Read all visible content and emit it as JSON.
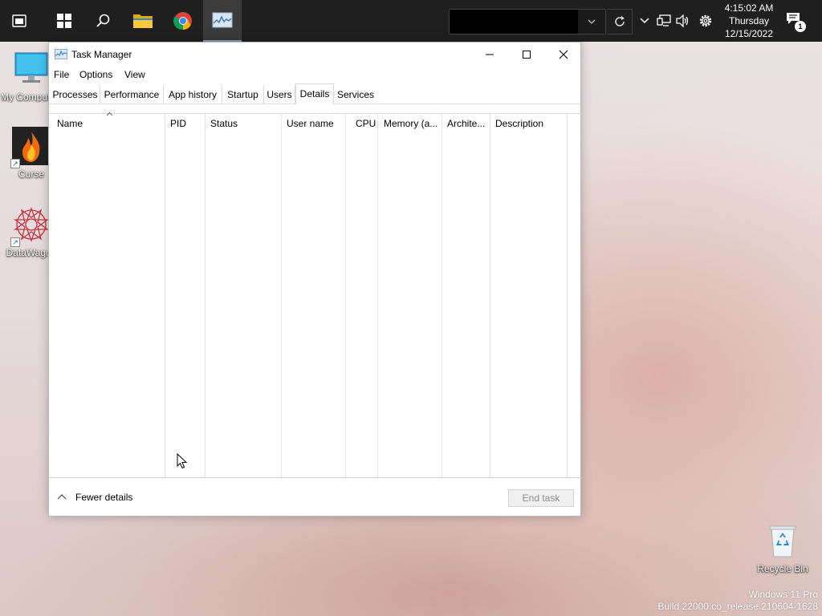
{
  "taskbar": {
    "apps": [
      {
        "name": "widgets"
      },
      {
        "name": "start"
      },
      {
        "name": "search"
      },
      {
        "name": "file-explorer"
      },
      {
        "name": "chrome"
      },
      {
        "name": "task-manager"
      }
    ],
    "search_value": "",
    "clock": {
      "time": "4:15:02 AM",
      "day": "Thursday",
      "date": "12/15/2022"
    },
    "notification_count": "1"
  },
  "desktop": {
    "icons": [
      {
        "label": "My Computer"
      },
      {
        "label": "Curse"
      },
      {
        "label": "DataWagon"
      },
      {
        "label": "Recycle Bin"
      }
    ],
    "watermark": {
      "line1": "Windows 11 Pro",
      "line2": "Build 22000.co_release.210604-1628"
    }
  },
  "window": {
    "title": "Task Manager",
    "menu": {
      "file": "File",
      "options": "Options",
      "view": "View"
    },
    "tabs": [
      "Processes",
      "Performance",
      "App history",
      "Startup",
      "Users",
      "Details",
      "Services"
    ],
    "active_tab": "Details",
    "columns": [
      "Name",
      "PID",
      "Status",
      "User name",
      "CPU",
      "Memory (a...",
      "Archite...",
      "Description"
    ],
    "rows": [],
    "footer": {
      "fewer_details": "Fewer details",
      "end_task": "End task"
    }
  },
  "colors": {
    "taskbar": "#1f1f1f",
    "window_bg": "#ffffff",
    "disabled_text": "#8c8c8c"
  }
}
